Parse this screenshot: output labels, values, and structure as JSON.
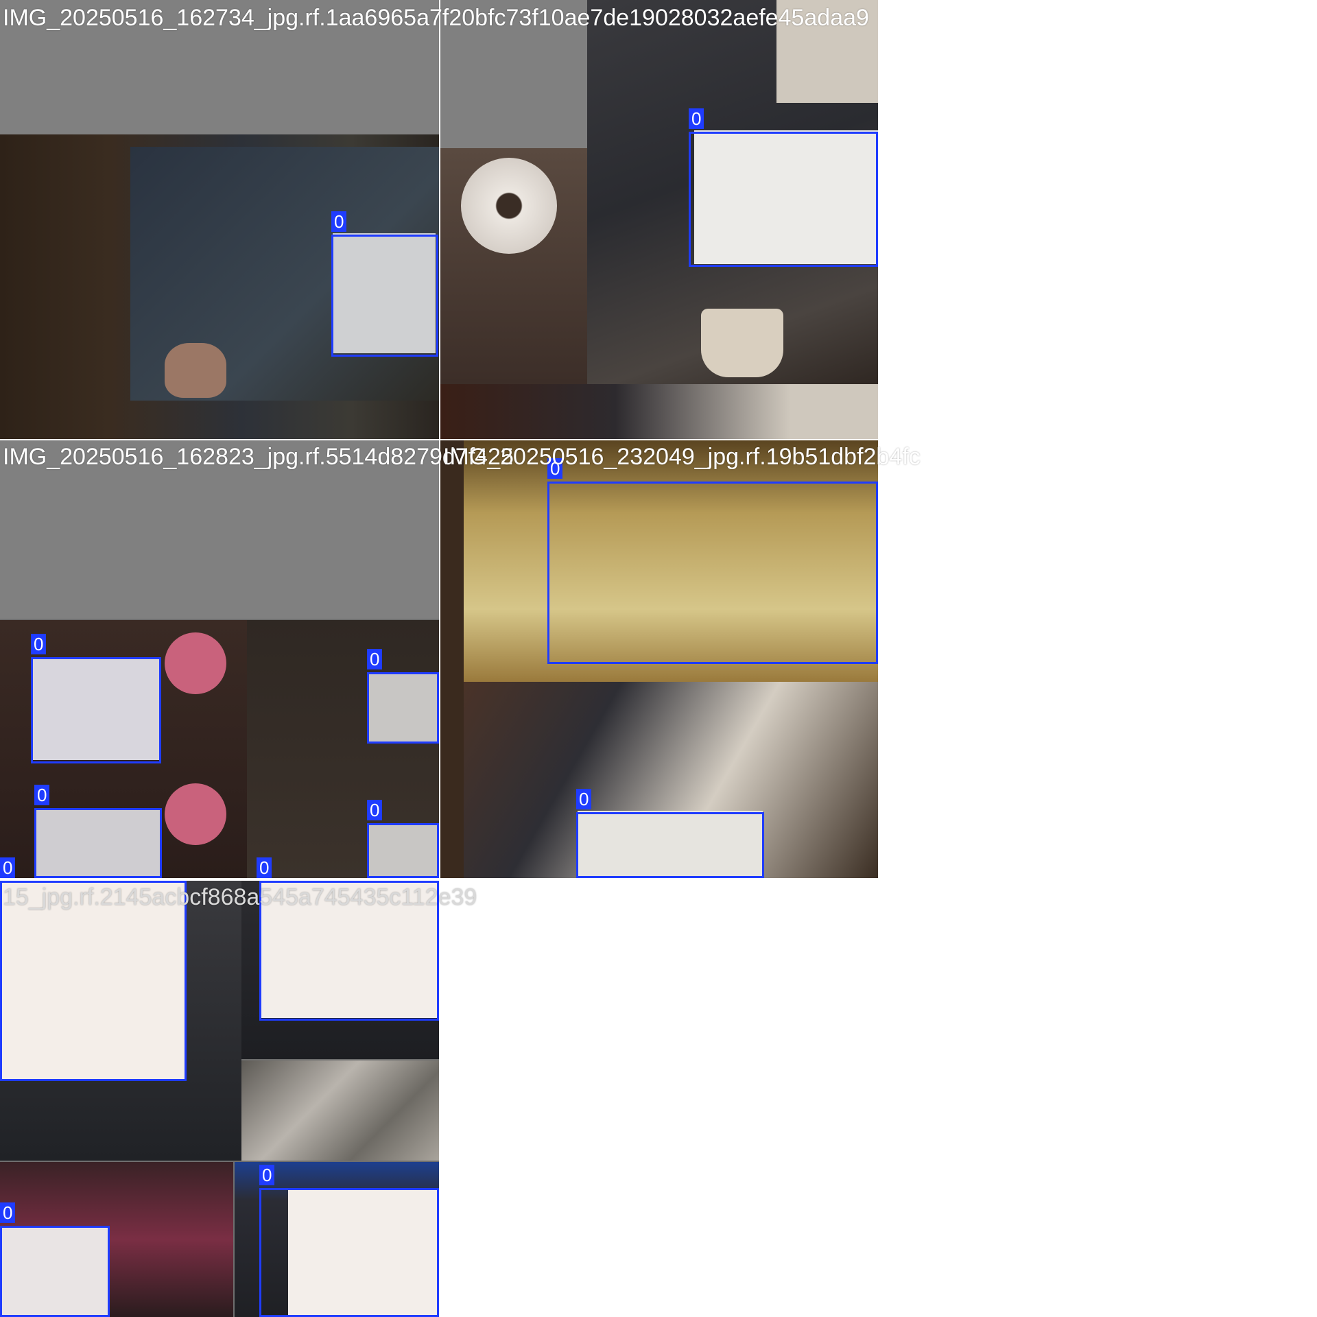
{
  "captions": {
    "c1": "IMG_20250516_162734_jpg.rf.1aa6965a7f20bfc73f10ae7de19028032aefe45adaa9",
    "c2": "IMG_20250516_162823_jpg.rf.5514d8279d7f425",
    "c3": "IMG_20250516_232049_jpg.rf.19b51dbf2b4fc",
    "c4": "15_jpg.rf.2145acbcf868a545a745435c112e39"
  },
  "class_label": "0"
}
